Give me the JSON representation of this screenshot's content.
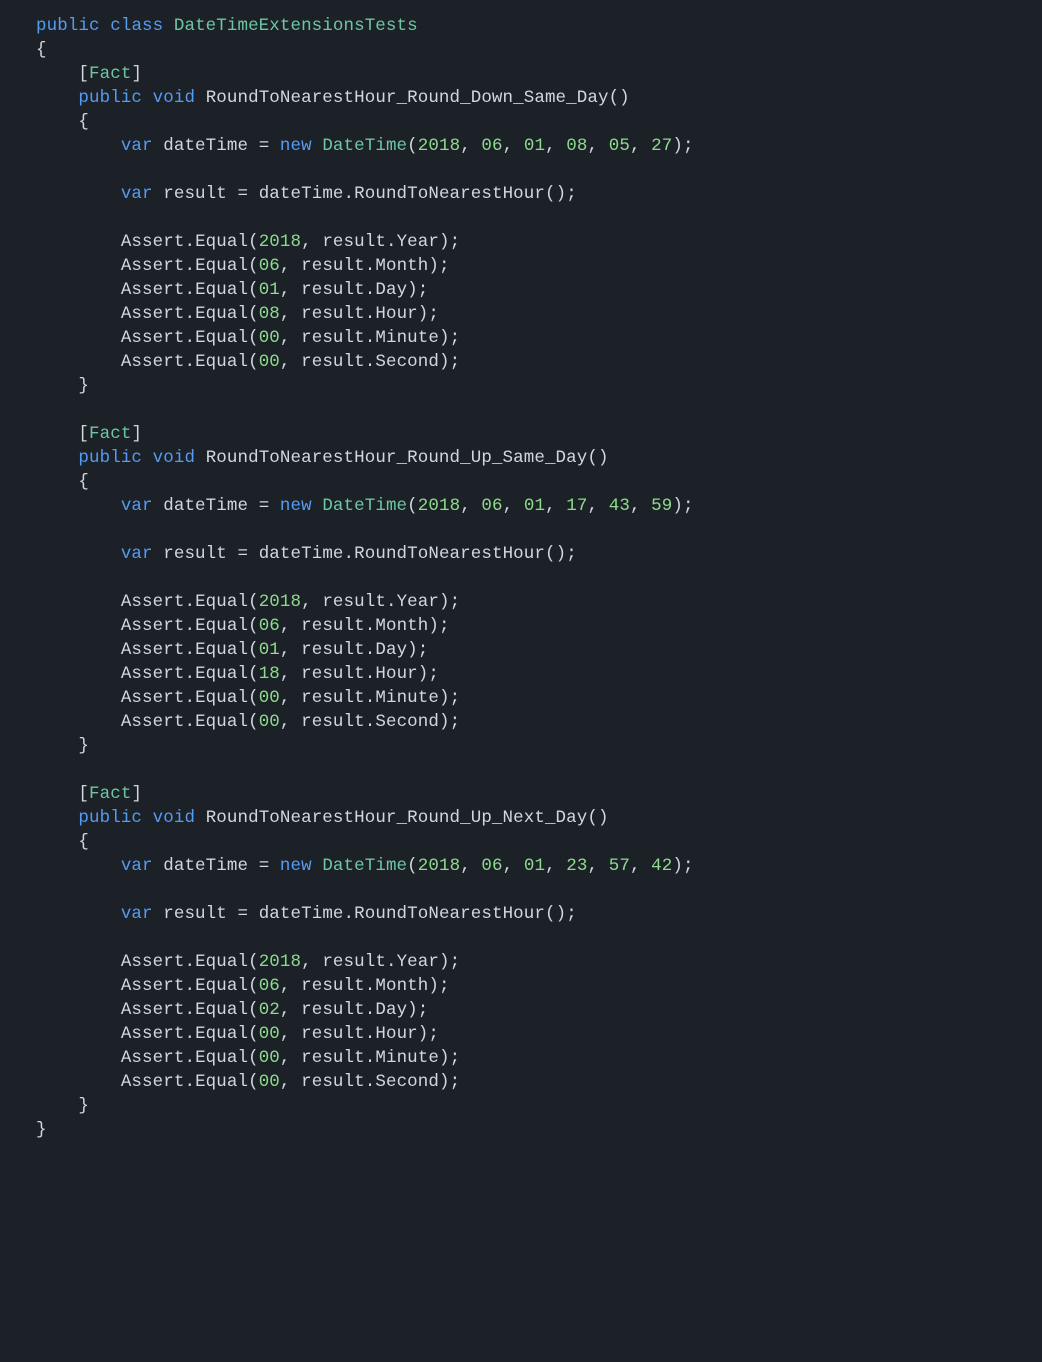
{
  "class_decl": {
    "modifier": "public",
    "kw_class": "class",
    "name": "DateTimeExtensionsTests"
  },
  "tests": [
    {
      "attr": "Fact",
      "modifier": "public",
      "ret": "void",
      "name": "RoundToNearestHour_Round_Down_Same_Day",
      "dt_args": [
        "2018",
        "06",
        "01",
        "08",
        "05",
        "27"
      ],
      "asserts": [
        {
          "expected": "2018",
          "prop": "Year"
        },
        {
          "expected": "06",
          "prop": "Month"
        },
        {
          "expected": "01",
          "prop": "Day"
        },
        {
          "expected": "08",
          "prop": "Hour"
        },
        {
          "expected": "00",
          "prop": "Minute"
        },
        {
          "expected": "00",
          "prop": "Second"
        }
      ]
    },
    {
      "attr": "Fact",
      "modifier": "public",
      "ret": "void",
      "name": "RoundToNearestHour_Round_Up_Same_Day",
      "dt_args": [
        "2018",
        "06",
        "01",
        "17",
        "43",
        "59"
      ],
      "asserts": [
        {
          "expected": "2018",
          "prop": "Year"
        },
        {
          "expected": "06",
          "prop": "Month"
        },
        {
          "expected": "01",
          "prop": "Day"
        },
        {
          "expected": "18",
          "prop": "Hour"
        },
        {
          "expected": "00",
          "prop": "Minute"
        },
        {
          "expected": "00",
          "prop": "Second"
        }
      ]
    },
    {
      "attr": "Fact",
      "modifier": "public",
      "ret": "void",
      "name": "RoundToNearestHour_Round_Up_Next_Day",
      "dt_args": [
        "2018",
        "06",
        "01",
        "23",
        "57",
        "42"
      ],
      "asserts": [
        {
          "expected": "2018",
          "prop": "Year"
        },
        {
          "expected": "06",
          "prop": "Month"
        },
        {
          "expected": "02",
          "prop": "Day"
        },
        {
          "expected": "00",
          "prop": "Hour"
        },
        {
          "expected": "00",
          "prop": "Minute"
        },
        {
          "expected": "00",
          "prop": "Second"
        }
      ]
    }
  ],
  "tokens": {
    "var": "var",
    "new": "new",
    "DateTime": "DateTime",
    "Assert": "Assert",
    "Equal": "Equal",
    "result": "result",
    "dateTime": "dateTime",
    "call": "RoundToNearestHour"
  }
}
